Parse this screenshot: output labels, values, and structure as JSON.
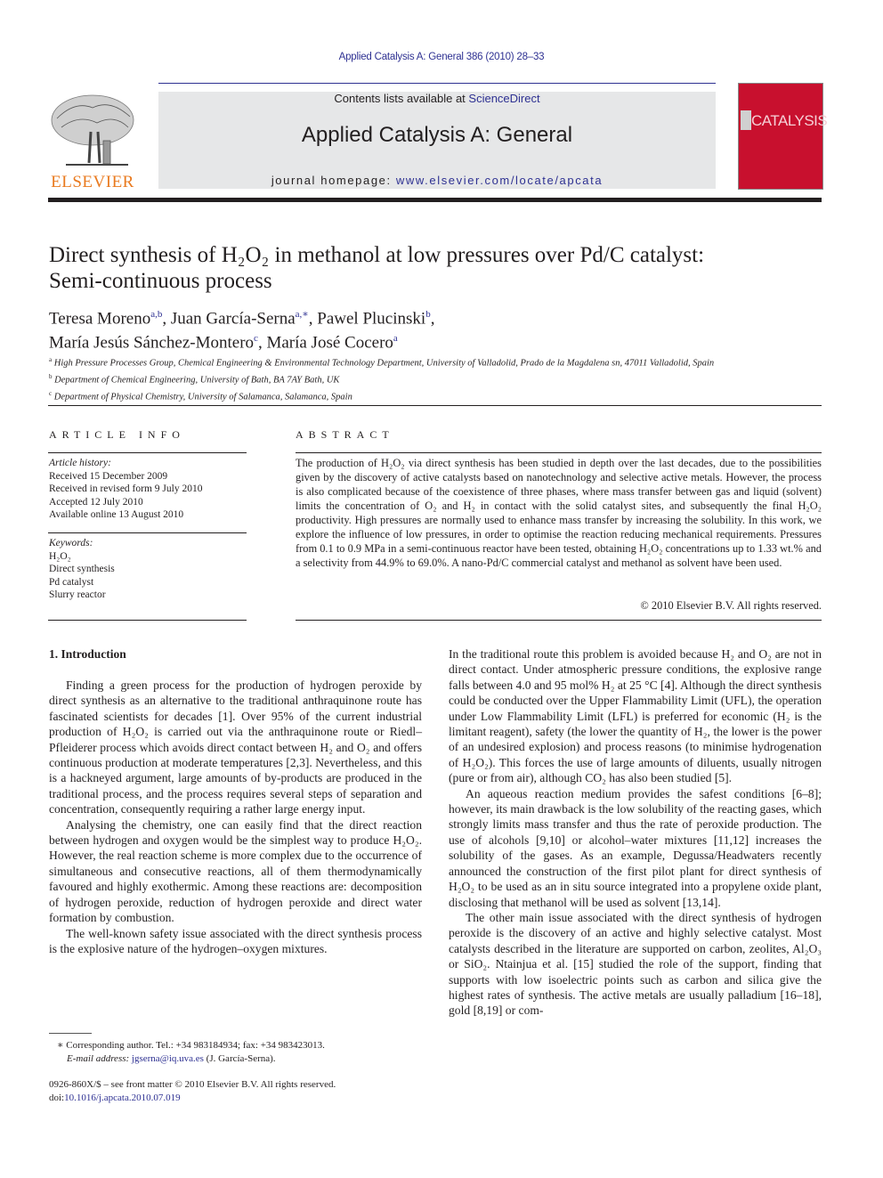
{
  "header": {
    "running_head": "Applied Catalysis A: General 386 (2010) 28–33",
    "contents_prefix": "Contents lists available at ",
    "contents_link": "ScienceDirect",
    "journal_title": "Applied Catalysis A: General",
    "homepage_prefix": "journal homepage: ",
    "homepage_link": "www.elsevier.com/locate/apcata",
    "publisher_logo_text": "ELSEVIER",
    "cover_text": "CATALYSIS",
    "colors": {
      "link": "#2e3192",
      "elsevier_orange": "#e97a1f",
      "cover_red": "#c8102e",
      "banner_gray": "#e6e7e8"
    }
  },
  "article": {
    "title_line1": "Direct synthesis of H₂O₂ in methanol at low pressures over Pd/C catalyst:",
    "title_line2": "Semi-continuous process",
    "authors": [
      {
        "name": "Teresa Moreno",
        "aff": "a,b",
        "sep": ", "
      },
      {
        "name": "Juan García-Serna",
        "aff": "a,∗",
        "sep": ", "
      },
      {
        "name": "Pawel Plucinski",
        "aff": "b",
        "sep": ","
      },
      {
        "name": "María Jesús Sánchez-Montero",
        "aff": "c",
        "sep": ", "
      },
      {
        "name": "María José Cocero",
        "aff": "a",
        "sep": ""
      }
    ],
    "affiliations": [
      {
        "key": "a",
        "text": "High Pressure Processes Group, Chemical Engineering & Environmental Technology Department, University of Valladolid, Prado de la Magdalena sn, 47011 Valladolid, Spain"
      },
      {
        "key": "b",
        "text": "Department of Chemical Engineering, University of Bath, BA 7AY Bath, UK"
      },
      {
        "key": "c",
        "text": "Department of Physical Chemistry, University of Salamanca, Salamanca, Spain"
      }
    ]
  },
  "article_info": {
    "heading": "ARTICLE INFO",
    "history_label": "Article history:",
    "history": [
      "Received 15 December 2009",
      "Received in revised form 9 July 2010",
      "Accepted 12 July 2010",
      "Available online 13 August 2010"
    ],
    "keywords_label": "Keywords:",
    "keywords": [
      "H₂O₂",
      "Direct synthesis",
      "Pd catalyst",
      "Slurry reactor"
    ]
  },
  "abstract": {
    "heading": "ABSTRACT",
    "text": "The production of H₂O₂ via direct synthesis has been studied in depth over the last decades, due to the possibilities given by the discovery of active catalysts based on nanotechnology and selective active metals. However, the process is also complicated because of the coexistence of three phases, where mass transfer between gas and liquid (solvent) limits the concentration of O₂ and H₂ in contact with the solid catalyst sites, and subsequently the final H₂O₂ productivity. High pressures are normally used to enhance mass transfer by increasing the solubility. In this work, we explore the influence of low pressures, in order to optimise the reaction reducing mechanical requirements. Pressures from 0.1 to 0.9 MPa in a semi-continuous reactor have been tested, obtaining H₂O₂ concentrations up to 1.33 wt.% and a selectivity from 44.9% to 69.0%. A nano-Pd/C commercial catalyst and methanol as solvent have been used.",
    "copyright": "© 2010 Elsevier B.V. All rights reserved."
  },
  "body": {
    "section_heading": "1.  Introduction",
    "left_paragraphs": [
      "Finding a green process for the production of hydrogen peroxide by direct synthesis as an alternative to the traditional anthraquinone route has fascinated scientists for decades [1]. Over 95% of the current industrial production of H₂O₂ is carried out via the anthraquinone route or Riedl–Pfleiderer process which avoids direct contact between H₂ and O₂ and offers continuous production at moderate temperatures [2,3]. Nevertheless, and this is a hackneyed argument, large amounts of by-products are produced in the traditional process, and the process requires several steps of separation and concentration, consequently requiring a rather large energy input.",
      "Analysing the chemistry, one can easily find that the direct reaction between hydrogen and oxygen would be the simplest way to produce H₂O₂. However, the real reaction scheme is more complex due to the occurrence of simultaneous and consecutive reactions, all of them thermodynamically favoured and highly exothermic. Among these reactions are: decomposition of hydrogen peroxide, reduction of hydrogen peroxide and direct water formation by combustion.",
      "The well-known safety issue associated with the direct synthesis process is the explosive nature of the hydrogen–oxygen mixtures."
    ],
    "right_paragraphs": [
      "In the traditional route this problem is avoided because H₂ and O₂ are not in direct contact. Under atmospheric pressure conditions, the explosive range falls between 4.0 and 95 mol% H₂ at 25 °C [4]. Although the direct synthesis could be conducted over the Upper Flammability Limit (UFL), the operation under Low Flammability Limit (LFL) is preferred for economic (H₂ is the limitant reagent), safety (the lower the quantity of H₂, the lower is the power of an undesired explosion) and process reasons (to minimise hydrogenation of H₂O₂). This forces the use of large amounts of diluents, usually nitrogen (pure or from air), although CO₂ has also been studied [5].",
      "An aqueous reaction medium provides the safest conditions [6–8]; however, its main drawback is the low solubility of the reacting gases, which strongly limits mass transfer and thus the rate of peroxide production. The use of alcohols [9,10] or alcohol–water mixtures [11,12] increases the solubility of the gases. As an example, Degussa/Headwaters recently announced the construction of the first pilot plant for direct synthesis of H₂O₂ to be used as an in situ source integrated into a propylene oxide plant, disclosing that methanol will be used as solvent [13,14].",
      "The other main issue associated with the direct synthesis of hydrogen peroxide is the discovery of an active and highly selective catalyst. Most catalysts described in the literature are supported on carbon, zeolites, Al₂O₃ or SiO₂. Ntainjua et al. [15] studied the role of the support, finding that supports with low isoelectric points such as carbon and silica give the highest rates of synthesis. The active metals are usually palladium [16–18], gold [8,19] or com-"
    ]
  },
  "footnotes": {
    "corresponding": "∗ Corresponding author. Tel.: +34 983184934; fax: +34 983423013.",
    "email_label": "E-mail address: ",
    "email": "jgserna@iq.uva.es",
    "email_suffix": " (J. García-Serna).",
    "front_matter": "0926-860X/$ – see front matter © 2010 Elsevier B.V. All rights reserved.",
    "doi_prefix": "doi:",
    "doi": "10.1016/j.apcata.2010.07.019"
  }
}
